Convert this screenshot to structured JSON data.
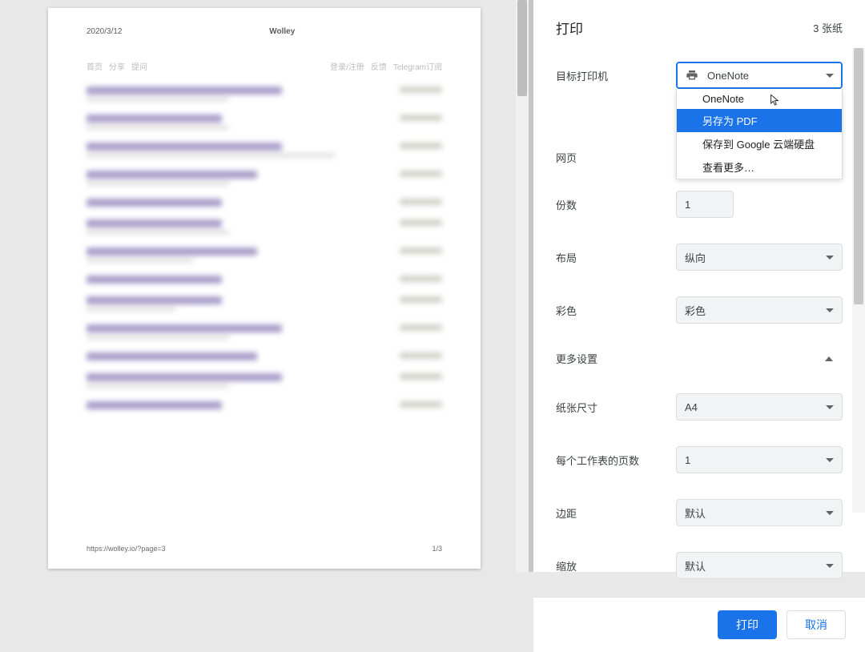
{
  "preview": {
    "date": "2020/3/12",
    "title": "Wolley",
    "nav_left": [
      "首页",
      "分享",
      "提问"
    ],
    "nav_right": [
      "登录/注册",
      "反馈",
      "Telegram订阅"
    ],
    "footer_url": "https://wolley.io/?page=3",
    "footer_page": "1/3"
  },
  "panel": {
    "heading": "打印",
    "sheet_count": "3 张纸",
    "rows": {
      "destination_label": "目标打印机",
      "destination_value": "OneNote",
      "pages_label": "网页",
      "copies_label": "份数",
      "copies_value": "1",
      "layout_label": "布局",
      "layout_value": "纵向",
      "color_label": "彩色",
      "color_value": "彩色",
      "more_settings": "更多设置",
      "paper_label": "纸张尺寸",
      "paper_value": "A4",
      "per_sheet_label": "每个工作表的页数",
      "per_sheet_value": "1",
      "margins_label": "边距",
      "margins_value": "默认",
      "scale_label": "缩放",
      "scale_value": "默认"
    },
    "dropdown": {
      "items": [
        "OneNote",
        "另存为 PDF",
        "保存到 Google 云端硬盘",
        "查看更多…"
      ],
      "selected_index": 1
    },
    "actions": {
      "print": "打印",
      "cancel": "取消"
    }
  }
}
